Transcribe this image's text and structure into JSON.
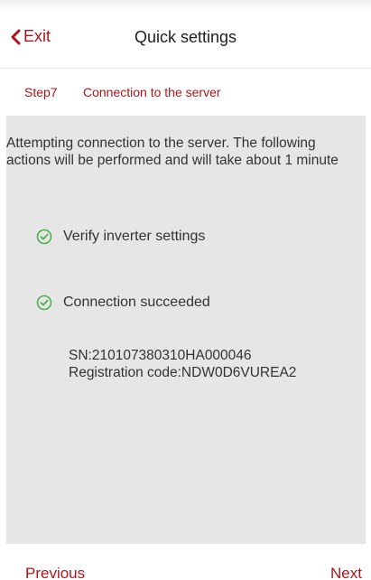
{
  "header": {
    "back_label": "Exit",
    "title": "Quick settings"
  },
  "step": {
    "number": "Step7",
    "name": "Connection to the server"
  },
  "content": {
    "description": "Attempting connection to the server. The following actions will be performed and will take about 1 minute",
    "items": [
      {
        "label": "Verify inverter settings",
        "icon": "check-circle-icon"
      },
      {
        "label": "Connection succeeded",
        "icon": "check-circle-icon"
      }
    ],
    "sn": "SN:210107380310HA000046",
    "registration": "Registration code:NDW0D6VUREA2"
  },
  "footer": {
    "previous_label": "Previous",
    "next_label": "Next"
  },
  "colors": {
    "accent": "#b1151b",
    "panel_bg": "#e6e6e6",
    "check_green": "#4caf50"
  }
}
